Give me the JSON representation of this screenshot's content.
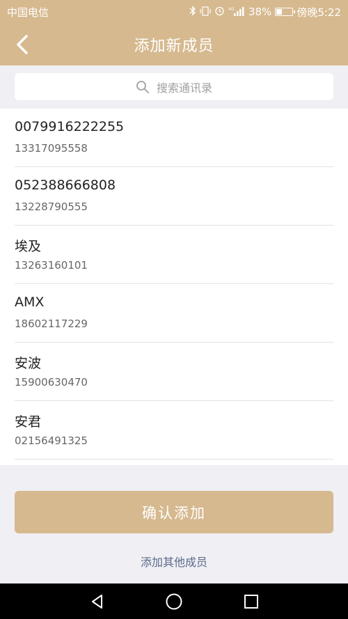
{
  "status_bar": {
    "carrier": "中国电信",
    "battery_percent": "38%",
    "battery_level": 0.38,
    "time": "傍晚5:22",
    "icons": [
      "bluetooth-icon",
      "vibrate-icon",
      "alarm-icon",
      "signal-icon",
      "battery-icon"
    ]
  },
  "header": {
    "title": "添加新成员",
    "back_icon": "chevron-left-icon"
  },
  "search": {
    "placeholder": "搜索通讯录",
    "icon": "search-icon"
  },
  "contacts": [
    {
      "name": "0079916222255",
      "phone": "13317095558"
    },
    {
      "name": "052388666808",
      "phone": "13228790555"
    },
    {
      "name": "埃及",
      "phone": "13263160101"
    },
    {
      "name": "AMX",
      "phone": "18602117229"
    },
    {
      "name": "安波",
      "phone": "15900630470"
    },
    {
      "name": "安君",
      "phone": "02156491325"
    }
  ],
  "actions": {
    "confirm_label": "确认添加",
    "add_other_label": "添加其他成员"
  },
  "colors": {
    "accent": "#d6b98f",
    "background": "#efeff4",
    "link": "#5a6a8a"
  },
  "system_nav": [
    "back-triangle-icon",
    "home-circle-icon",
    "recents-square-icon"
  ]
}
